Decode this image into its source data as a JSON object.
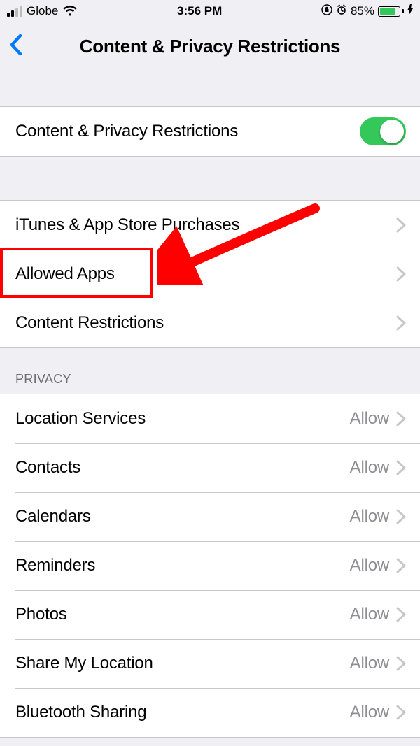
{
  "statusBar": {
    "carrier": "Globe",
    "time": "3:56 PM",
    "batteryPercent": "85%"
  },
  "header": {
    "title": "Content & Privacy Restrictions"
  },
  "toggleRow": {
    "label": "Content & Privacy Restrictions"
  },
  "navRows": [
    {
      "label": "iTunes & App Store Purchases"
    },
    {
      "label": "Allowed Apps"
    },
    {
      "label": "Content Restrictions"
    }
  ],
  "privacy": {
    "header": "PRIVACY",
    "rows": [
      {
        "label": "Location Services",
        "value": "Allow"
      },
      {
        "label": "Contacts",
        "value": "Allow"
      },
      {
        "label": "Calendars",
        "value": "Allow"
      },
      {
        "label": "Reminders",
        "value": "Allow"
      },
      {
        "label": "Photos",
        "value": "Allow"
      },
      {
        "label": "Share My Location",
        "value": "Allow"
      },
      {
        "label": "Bluetooth Sharing",
        "value": "Allow"
      }
    ]
  }
}
